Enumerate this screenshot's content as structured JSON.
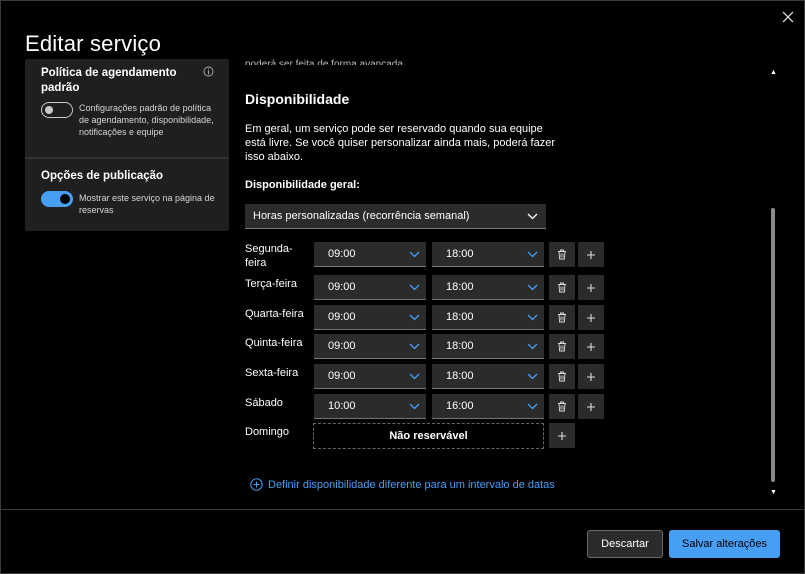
{
  "dialog": {
    "title": "Editar serviço",
    "close_icon": "close-icon"
  },
  "left_panel": {
    "policy": {
      "heading": "Política de agendamento padrão",
      "toggle_on": false,
      "description": "Configurações padrão de política de agendamento, disponibilidade, notificações e equipe",
      "info_icon": "info-icon"
    },
    "publish": {
      "heading": "Opções de publicação",
      "toggle_on": true,
      "description": "Mostrar este serviço na página de reservas"
    }
  },
  "main": {
    "cut_text": "poderá ser feita de forma avançada",
    "section_title": "Disponibilidade",
    "description": "Em geral, um serviço pode ser reservado quando sua equipe está livre. Se você quiser personalizar ainda mais, poderá fazer isso abaixo.",
    "general_label": "Disponibilidade geral:",
    "general_select": "Horas personalizadas (recorrência semanal)",
    "days": [
      {
        "name": "Segunda-feira",
        "start": "09:00",
        "end": "18:00"
      },
      {
        "name": "Terça-feira",
        "start": "09:00",
        "end": "18:00"
      },
      {
        "name": "Quarta-feira",
        "start": "09:00",
        "end": "18:00"
      },
      {
        "name": "Quinta-feira",
        "start": "09:00",
        "end": "18:00"
      },
      {
        "name": "Sexta-feira",
        "start": "09:00",
        "end": "18:00"
      },
      {
        "name": "Sábado",
        "start": "10:00",
        "end": "16:00"
      },
      {
        "name": "Domingo",
        "not_bookable": "Não reservável"
      }
    ],
    "date_range_link": "Definir disponibilidade diferente para um intervalo de datas"
  },
  "footer": {
    "discard_label": "Descartar",
    "save_label": "Salvar alterações"
  },
  "colors": {
    "accent": "#479ef5",
    "background": "#000000",
    "surface": "#2b2b2b",
    "panel": "#1f1f1f"
  }
}
